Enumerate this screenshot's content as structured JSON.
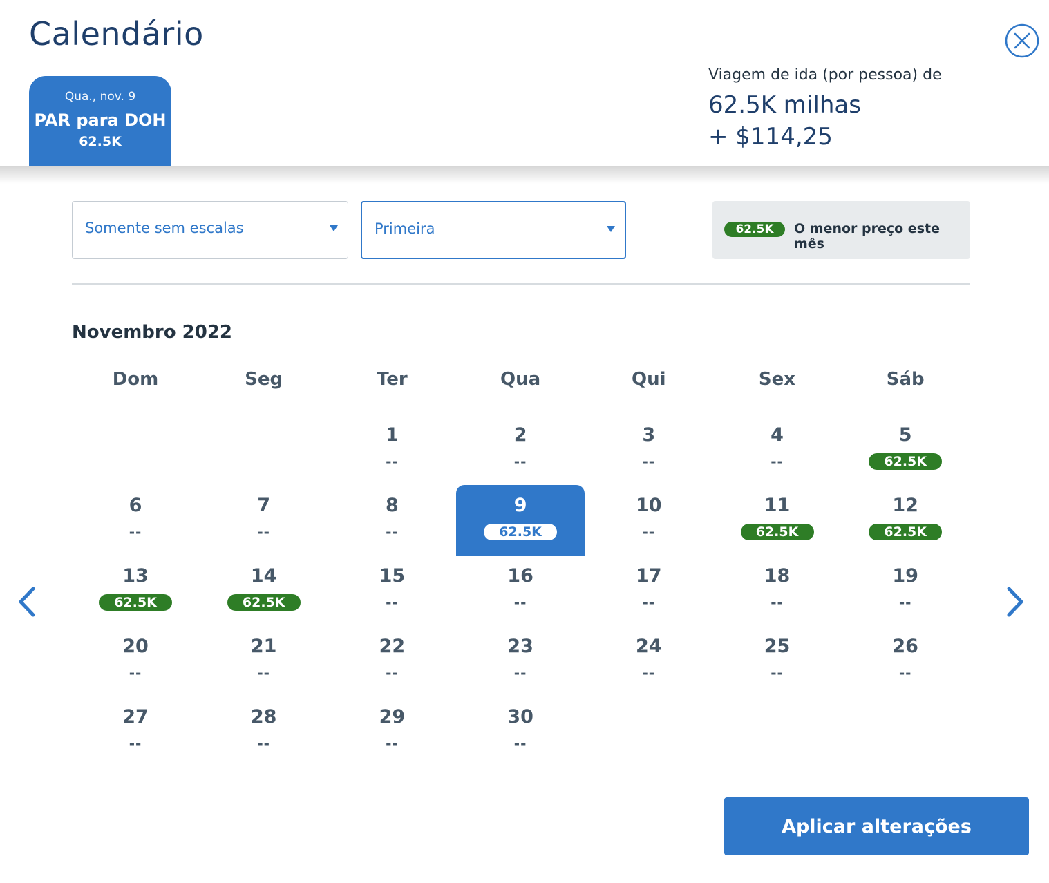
{
  "header": {
    "title": "Calendário",
    "close_icon": "close-circle-icon"
  },
  "trip_tab": {
    "date": "Qua., nov. 9",
    "route": "PAR para DOH",
    "price": "62.5K"
  },
  "fare_summary": {
    "label": "Viagem de ida (por pessoa) de",
    "miles": "62.5K milhas",
    "cash": "+ $114,25"
  },
  "filters": {
    "stops": {
      "value": "Somente sem escalas"
    },
    "cabin": {
      "value": "Primeira"
    }
  },
  "legend": {
    "pill": "62.5K",
    "text": "O menor preço este mês"
  },
  "calendar": {
    "month": "Novembro 2022",
    "weekdays": [
      "Dom",
      "Seg",
      "Ter",
      "Qua",
      "Qui",
      "Sex",
      "Sáb"
    ],
    "no_fare": "--",
    "selected_day": 9,
    "days": [
      {
        "day": "1",
        "fare": null
      },
      {
        "day": "2",
        "fare": null
      },
      {
        "day": "3",
        "fare": null
      },
      {
        "day": "4",
        "fare": null
      },
      {
        "day": "5",
        "fare": "62.5K"
      },
      {
        "day": "6",
        "fare": null
      },
      {
        "day": "7",
        "fare": null
      },
      {
        "day": "8",
        "fare": null
      },
      {
        "day": "9",
        "fare": "62.5K"
      },
      {
        "day": "10",
        "fare": null
      },
      {
        "day": "11",
        "fare": "62.5K"
      },
      {
        "day": "12",
        "fare": "62.5K"
      },
      {
        "day": "13",
        "fare": "62.5K"
      },
      {
        "day": "14",
        "fare": "62.5K"
      },
      {
        "day": "15",
        "fare": null
      },
      {
        "day": "16",
        "fare": null
      },
      {
        "day": "17",
        "fare": null
      },
      {
        "day": "18",
        "fare": null
      },
      {
        "day": "19",
        "fare": null
      },
      {
        "day": "20",
        "fare": null
      },
      {
        "day": "21",
        "fare": null
      },
      {
        "day": "22",
        "fare": null
      },
      {
        "day": "23",
        "fare": null
      },
      {
        "day": "24",
        "fare": null
      },
      {
        "day": "25",
        "fare": null
      },
      {
        "day": "26",
        "fare": null
      },
      {
        "day": "27",
        "fare": null
      },
      {
        "day": "28",
        "fare": null
      },
      {
        "day": "29",
        "fare": null
      },
      {
        "day": "30",
        "fare": null
      }
    ]
  },
  "navigation": {
    "prev_icon": "chevron-left-icon",
    "next_icon": "chevron-right-icon"
  },
  "actions": {
    "apply_label": "Aplicar alterações"
  },
  "colors": {
    "brand_blue": "#3078c9",
    "title_navy": "#1f3f6b",
    "fare_green": "#2e7d26"
  }
}
